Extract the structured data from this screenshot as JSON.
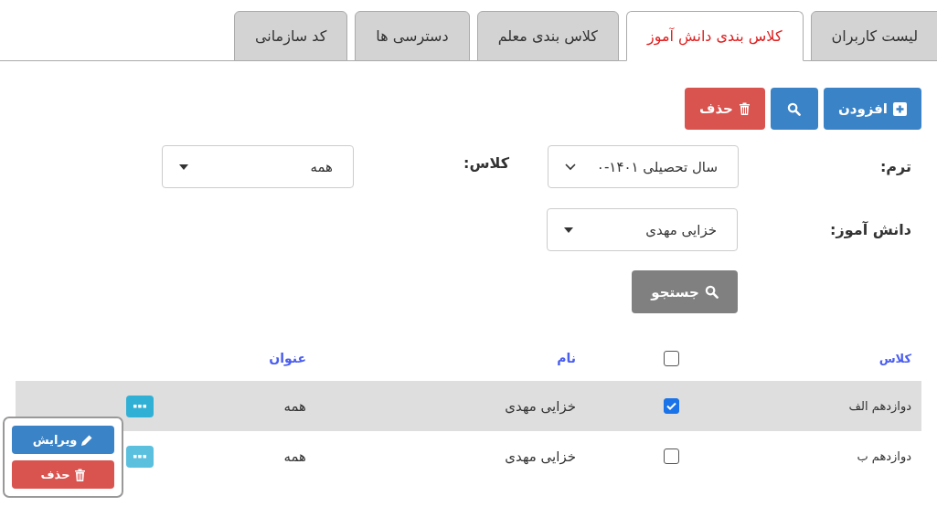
{
  "tabs": [
    {
      "label": "لیست کاربران",
      "selected": false
    },
    {
      "label": "کلاس بندی دانش آموز",
      "selected": true
    },
    {
      "label": "کلاس بندی معلم",
      "selected": false
    },
    {
      "label": "دسترسی ها",
      "selected": false
    },
    {
      "label": "کد سازمانی",
      "selected": false
    }
  ],
  "toolbar": [
    {
      "kind": "add",
      "label": "افزودن"
    },
    {
      "kind": "search"
    },
    {
      "kind": "delete",
      "label": "حذف"
    }
  ],
  "filters": {
    "term": {
      "label": "ترم:",
      "value": "سال تحصیلی ۱۴۰۱-۰"
    },
    "class": {
      "label": "کلاس:",
      "value": "همه"
    },
    "student": {
      "label": "دانش آموز:",
      "value": "خزایی مهدی"
    },
    "search_button": "جستجو"
  },
  "table": {
    "columns": [
      "کلاس",
      "",
      "نام",
      "عنوان"
    ],
    "header_checked": false,
    "rows": [
      {
        "class": "دوازدهم الف",
        "checked": true,
        "name": "خزایی مهدی",
        "title": "همه",
        "selected": true,
        "expanded": false
      },
      {
        "class": "دوازدهم ب",
        "checked": false,
        "name": "خزایی مهدی",
        "title": "همه",
        "selected": false,
        "expanded": true
      }
    ]
  },
  "row_menu": [
    {
      "kind": "edit",
      "label": "ویرایش"
    },
    {
      "kind": "delete",
      "label": "حذف"
    }
  ]
}
